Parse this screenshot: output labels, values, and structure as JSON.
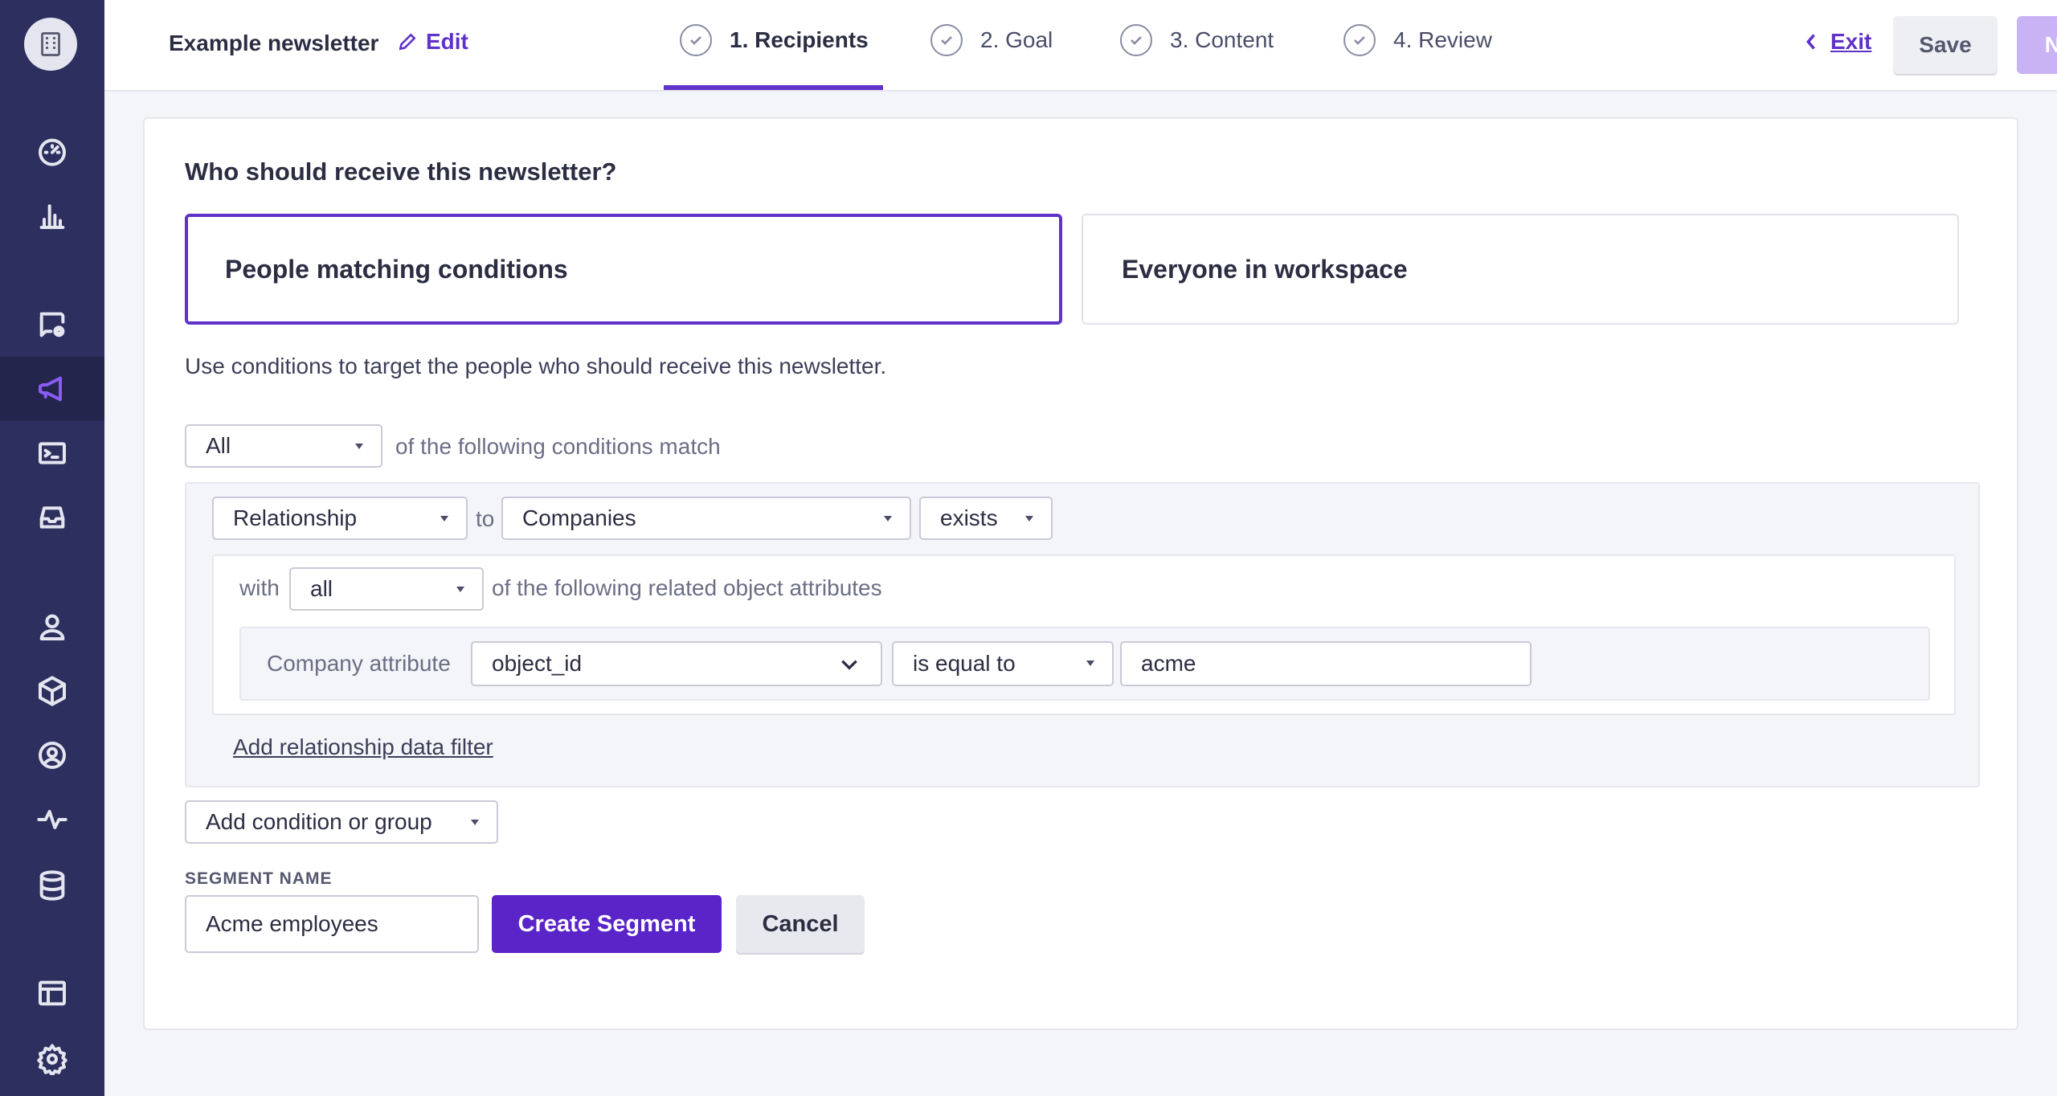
{
  "header": {
    "newsletter_title": "Example newsletter",
    "edit_label": "Edit",
    "steps": [
      {
        "label": "1. Recipients",
        "active": true
      },
      {
        "label": "2. Goal",
        "active": false
      },
      {
        "label": "3. Content",
        "active": false
      },
      {
        "label": "4. Review",
        "active": false
      }
    ],
    "exit_label": "Exit",
    "save_label": "Save",
    "next_label": "Next"
  },
  "sidebar": {
    "icons": [
      "building-icon",
      "dashboard-icon",
      "bar-chart-icon",
      "chat-settings-icon",
      "megaphone-icon",
      "terminal-icon",
      "inbox-icon",
      "person-icon",
      "cube-icon",
      "user-circle-icon",
      "activity-icon",
      "database-icon",
      "table-icon",
      "gear-icon"
    ],
    "active": "megaphone-icon"
  },
  "recipients": {
    "question": "Who should receive this newsletter?",
    "options": [
      "People matching conditions",
      "Everyone in workspace"
    ],
    "selected": "People matching conditions",
    "hint": "Use conditions to target the people who should receive this newsletter.",
    "match_select": "All",
    "match_text": "of the following conditions match",
    "condition": {
      "type_select": "Relationship",
      "to_text": "to",
      "object_select": "Companies",
      "operator_select": "exists",
      "with_text": "with",
      "scope_select": "all",
      "scope_text": "of the following related object attributes",
      "attribute_label": "Company attribute",
      "attribute_select": "object_id",
      "comparator_select": "is equal to",
      "value": "acme"
    },
    "add_filter_label": "Add relationship data filter",
    "add_condition_label": "Add condition or group",
    "segment_name_label": "SEGMENT NAME",
    "segment_name_value": "Acme employees",
    "create_label": "Create Segment",
    "cancel_label": "Cancel"
  },
  "colors": {
    "brand": "#5a24c9",
    "sidebar": "#2d2f5f",
    "active_icon": "#8a5cf6"
  }
}
